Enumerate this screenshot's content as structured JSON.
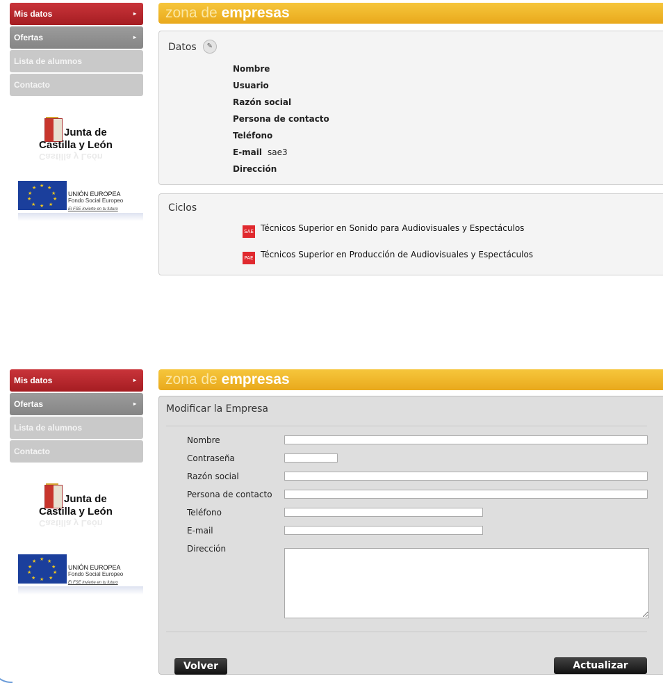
{
  "sidebar": {
    "items": [
      {
        "label": "Mis datos",
        "arrow": "▸"
      },
      {
        "label": "Ofertas",
        "arrow": "▸"
      },
      {
        "label": "Lista de alumnos"
      },
      {
        "label": "Contacto"
      }
    ],
    "jcyl": {
      "line1": "Junta de",
      "line2": "Castilla y León"
    },
    "ue": {
      "line1": "UNIÓN EUROPEA",
      "line2": "Fondo Social Europeo",
      "line3": "El FSE invierte en tu futuro"
    }
  },
  "header": {
    "zona": "zona de",
    "empresas": "empresas"
  },
  "datos": {
    "title": "Datos",
    "fields": [
      {
        "label": "Nombre",
        "value": ""
      },
      {
        "label": "Usuario",
        "value": ""
      },
      {
        "label": "Razón social",
        "value": ""
      },
      {
        "label": "Persona de contacto",
        "value": ""
      },
      {
        "label": "Teléfono",
        "value": ""
      },
      {
        "label": "E-mail",
        "value": "sae3"
      },
      {
        "label": "Dirección",
        "value": ""
      }
    ]
  },
  "ciclos": {
    "title": "Ciclos",
    "items": [
      {
        "badge": "SAE",
        "label": "Técnicos Superior en Sonido para Audiovisuales y Espectáculos"
      },
      {
        "badge": "PAE",
        "label": "Técnicos Superior en Producción de Audiovisuales y Espectáculos"
      }
    ]
  },
  "form": {
    "title": "Modificar la Empresa",
    "labels": {
      "nombre": "Nombre",
      "contrasena": "Contraseña",
      "razon": "Razón social",
      "persona": "Persona de contacto",
      "telefono": "Teléfono",
      "email": "E-mail",
      "direccion": "Dirección"
    },
    "values": {
      "nombre": "",
      "contrasena": "",
      "razon": "",
      "persona": "",
      "telefono": "",
      "email": "",
      "direccion": ""
    },
    "buttons": {
      "volver": "Volver",
      "actualizar": "Actualizar"
    }
  },
  "colors": {
    "accent_red": "#b3232a",
    "header_yellow": "#f0b52a"
  }
}
